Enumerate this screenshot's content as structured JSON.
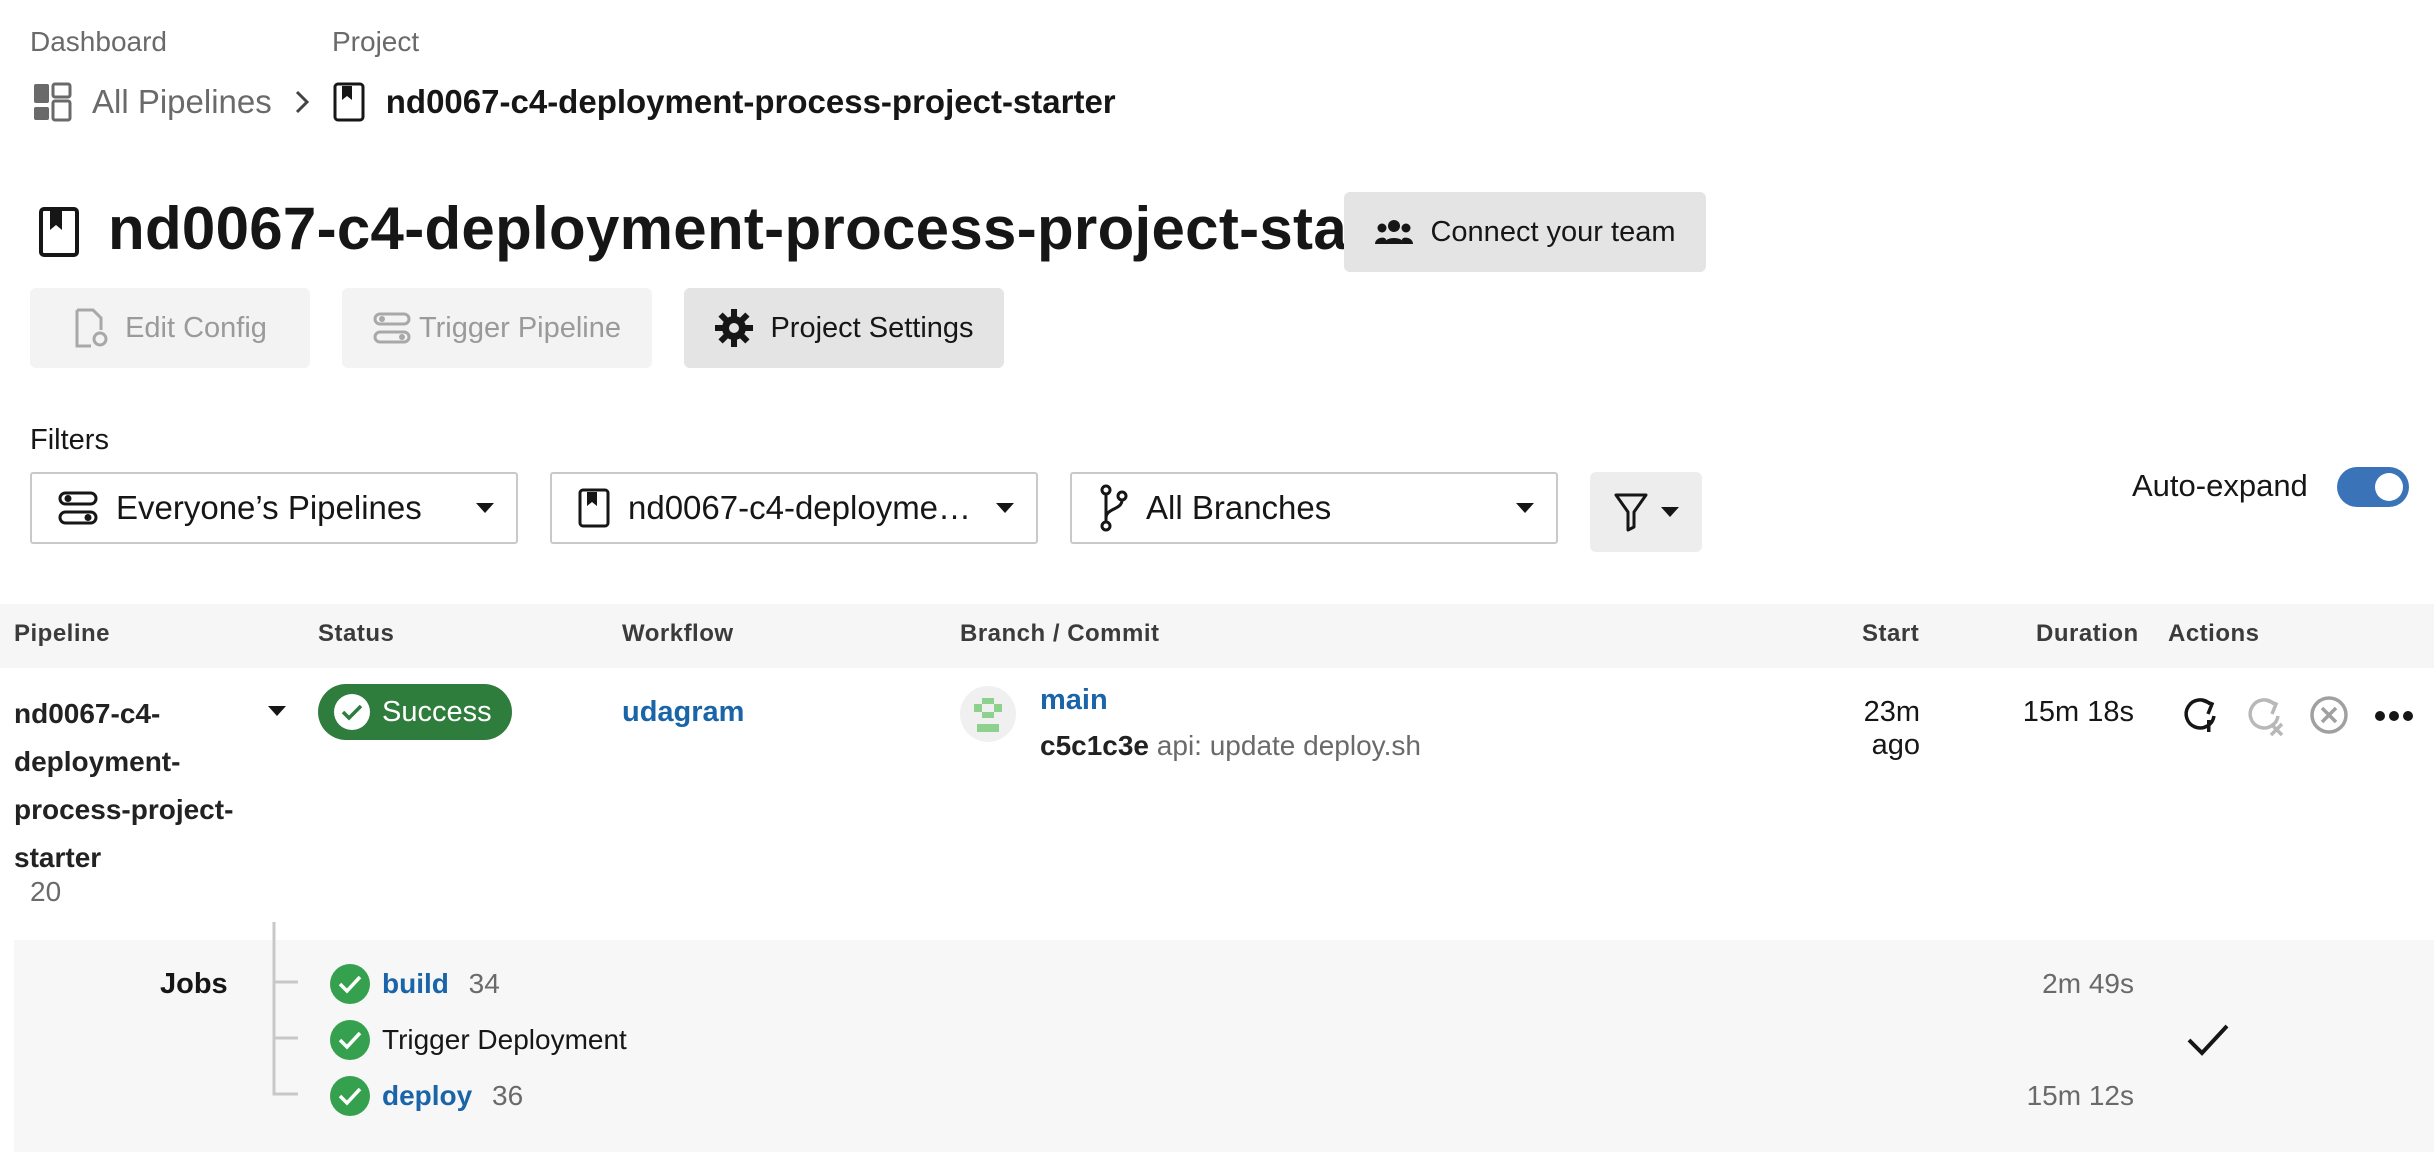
{
  "breadcrumb": {
    "dashboard_label": "Dashboard",
    "project_label": "Project",
    "all_pipelines": "All Pipelines",
    "project_name": "nd0067-c4-deployment-process-project-starter"
  },
  "header": {
    "title": "nd0067-c4-deployment-process-project-starter",
    "connect_team": "Connect your team",
    "edit_config": "Edit Config",
    "trigger_pipeline": "Trigger Pipeline",
    "project_settings": "Project Settings"
  },
  "filters": {
    "label": "Filters",
    "pipelines": "Everyone’s Pipelines",
    "project": "nd0067-c4-deploymen…",
    "branches": "All Branches",
    "auto_expand": "Auto-expand",
    "auto_expand_on": true
  },
  "table": {
    "headers": {
      "pipeline": "Pipeline",
      "status": "Status",
      "workflow": "Workflow",
      "branch_commit": "Branch / Commit",
      "start": "Start",
      "duration": "Duration",
      "actions": "Actions"
    },
    "row": {
      "pipeline_lines": [
        "nd0067-c4-",
        "deployment-",
        "process-project-",
        "starter"
      ],
      "pipeline_number": "20",
      "status": "Success",
      "workflow": "udagram",
      "branch": "main",
      "commit_hash": "c5c1c3e",
      "commit_message": "api: update deploy.sh",
      "start": "23m ago",
      "duration": "15m 18s"
    },
    "jobs_label": "Jobs",
    "jobs": [
      {
        "name": "build",
        "number": "34",
        "duration": "2m 49s"
      },
      {
        "name": "Trigger Deployment",
        "number": "",
        "duration": ""
      },
      {
        "name": "deploy",
        "number": "36",
        "duration": "15m 12s"
      }
    ]
  },
  "colors": {
    "success": "#2f7d3c",
    "job_success": "#35a04e",
    "link": "#1a64a8",
    "toggle": "#3b73b9"
  }
}
